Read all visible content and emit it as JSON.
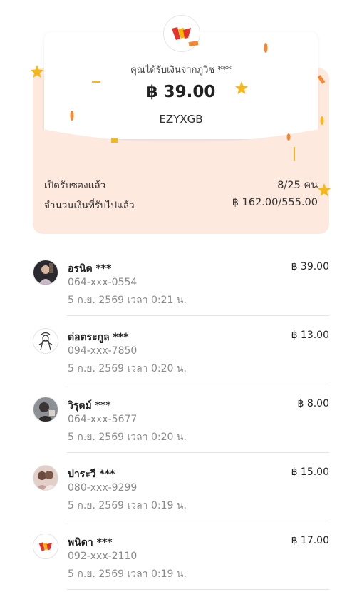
{
  "header": {
    "received_from": "คุณได้รับเงินจากภูวิช ***",
    "amount": "฿ 39.00",
    "code": "EZYXGB"
  },
  "stats": [
    {
      "label": "เปิดรับซองแล้ว",
      "value": "8/25 คน"
    },
    {
      "label": "จำนวนเงินที่รับไปแล้ว",
      "value": "฿ 162.00/555.00"
    }
  ],
  "recipients": [
    {
      "name": "อรนิต ***",
      "phone": "064-xxx-0554",
      "time": "5 ก.ย. 2569 เวลา 0:21 น.",
      "amount": "฿ 39.00",
      "avatar": "photo-avatar"
    },
    {
      "name": "ต่อตระกูล ***",
      "phone": "094-xxx-7850",
      "time": "5 ก.ย. 2569 เวลา 0:20 น.",
      "amount": "฿ 13.00",
      "avatar": "drawing-avatar"
    },
    {
      "name": "วิรุตม์ ***",
      "phone": "064-xxx-5677",
      "time": "5 ก.ย. 2569 เวลา 0:20 น.",
      "amount": "฿ 8.00",
      "avatar": "photo-avatar"
    },
    {
      "name": "ปาระวี ***",
      "phone": "080-xxx-9299",
      "time": "5 ก.ย. 2569 เวลา 0:19 น.",
      "amount": "฿ 15.00",
      "avatar": "photo-avatar"
    },
    {
      "name": "พนิดา ***",
      "phone": "092-xxx-2110",
      "time": "5 ก.ย. 2569 เวลา 0:19 น.",
      "amount": "฿ 17.00",
      "avatar": "wallet-logo-avatar"
    }
  ],
  "colors": {
    "hero_bg": "#fde9dd",
    "confetti_orange": "#f7882f",
    "confetti_yellow": "#f5b81c",
    "logo_red": "#e5322d",
    "logo_yellow": "#f7b500"
  }
}
